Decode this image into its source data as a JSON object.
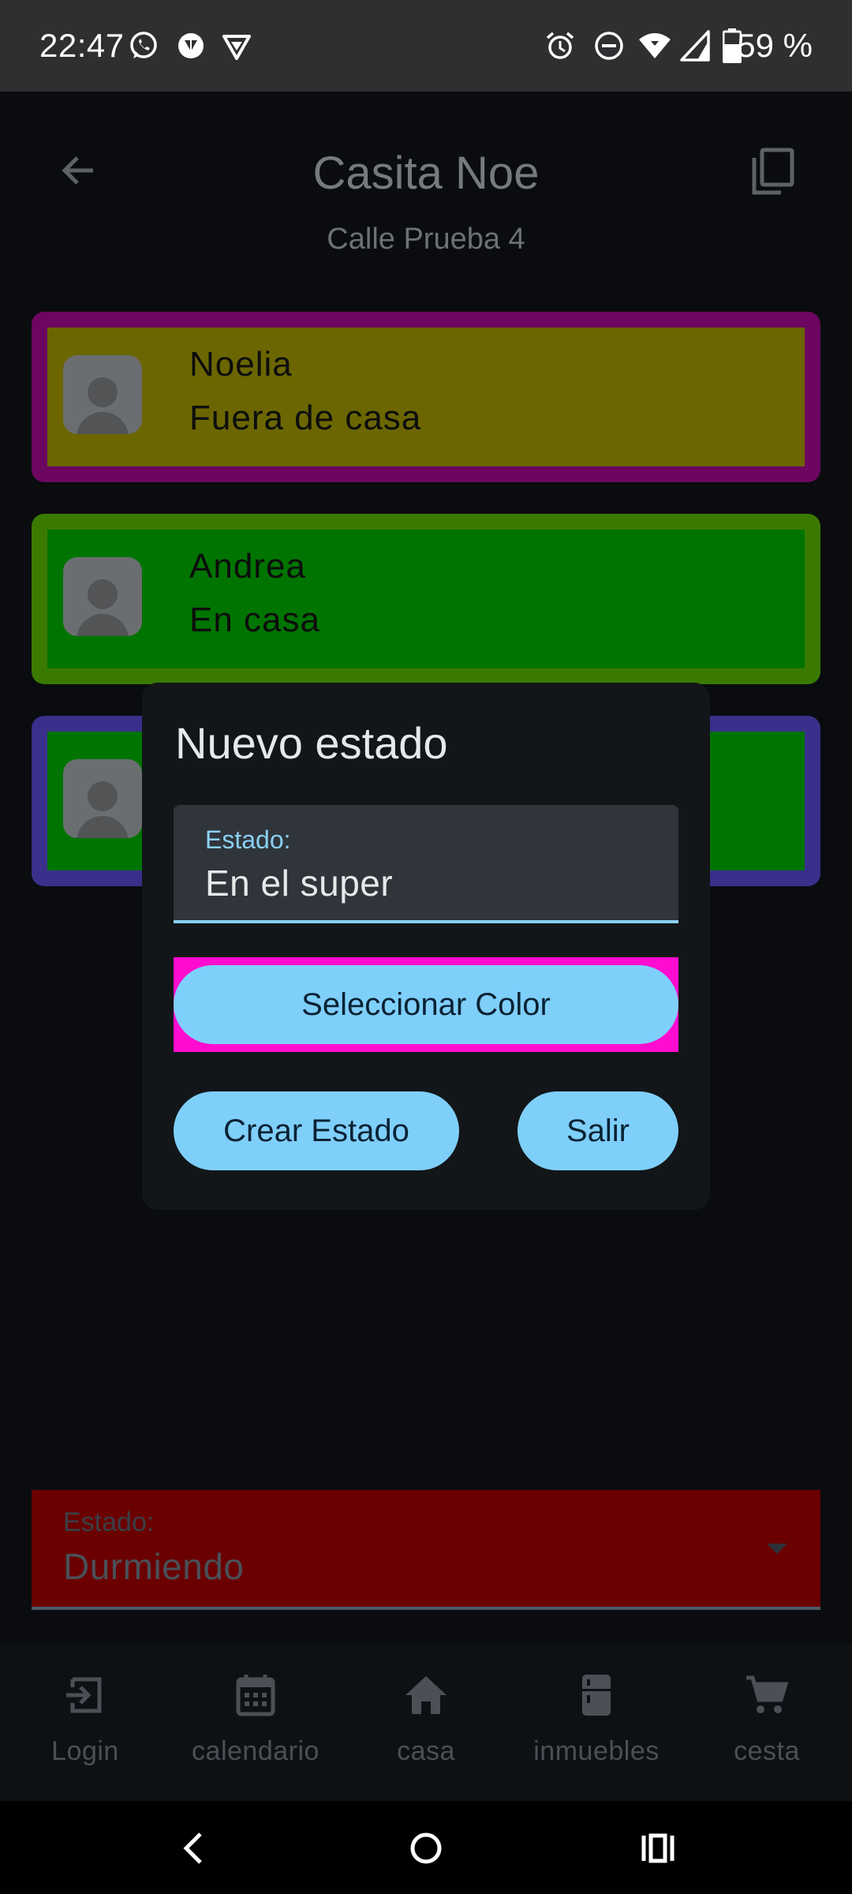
{
  "status_bar": {
    "time": "22:47",
    "battery": "59 %",
    "notification_icons": [
      "whatsapp-icon",
      "app-icon",
      "vpn-icon"
    ],
    "system_icons": [
      "alarm-icon",
      "do-not-disturb-icon",
      "wifi-icon",
      "signal-icon",
      "battery-icon"
    ]
  },
  "header": {
    "title": "Casita Noe",
    "subtitle": "Calle Prueba 4",
    "back_icon": "arrow-left-icon",
    "copy_icon": "copy-icon"
  },
  "members": [
    {
      "name": "Noelia",
      "status": "Fuera de casa",
      "border_color": "#6d0660",
      "fill_color": "#6b6600"
    },
    {
      "name": "Andrea",
      "status": "En casa",
      "border_color": "#3a7a00",
      "fill_color": "#007400"
    },
    {
      "name": "",
      "status": "",
      "border_color": "#3a2f8a",
      "fill_color": "#007400"
    }
  ],
  "dialog": {
    "title": "Nuevo estado",
    "field_label": "Estado:",
    "field_value": "En el super",
    "select_color_label": "Seleccionar Color",
    "selected_color": "#ff0cd0",
    "create_label": "Crear Estado",
    "exit_label": "Salir"
  },
  "state_select": {
    "label": "Estado:",
    "value": "Durmiendo",
    "color": "#6a0000"
  },
  "bottom_nav": [
    {
      "label": "Login",
      "icon": "login-icon"
    },
    {
      "label": "calendario",
      "icon": "calendar-icon"
    },
    {
      "label": "casa",
      "icon": "home-icon"
    },
    {
      "label": "inmuebles",
      "icon": "kitchen-icon"
    },
    {
      "label": "cesta",
      "icon": "cart-icon"
    }
  ],
  "system_nav": [
    "back-icon",
    "home-circle-icon",
    "recents-icon"
  ]
}
